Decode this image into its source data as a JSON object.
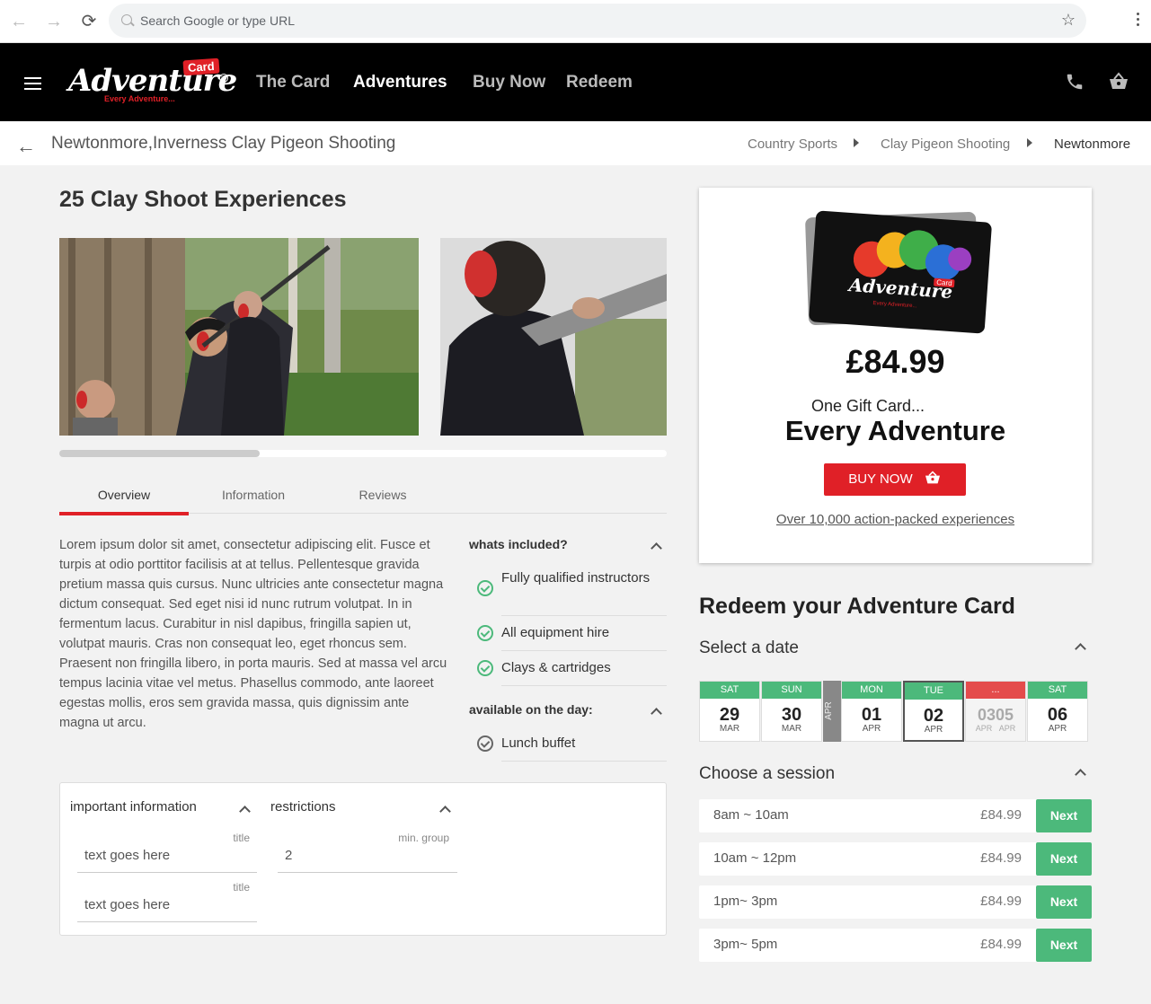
{
  "browser": {
    "search_placeholder": "Search Google or type URL"
  },
  "header": {
    "logo": {
      "word": "Adventure",
      "badge": "Card",
      "tagline": "Every Adventure...",
      "tm": "TM"
    },
    "nav": [
      "The Card",
      "Adventures",
      "Buy Now",
      "Redeem"
    ],
    "active_nav": "Adventures"
  },
  "breadcrumb": {
    "page_title": "Newtonmore,Inverness Clay Pigeon Shooting",
    "items": [
      "Country Sports",
      "Clay Pigeon Shooting",
      "Newtonmore"
    ]
  },
  "product": {
    "heading": "25 Clay Shoot Experiences",
    "carousel_scroll_fraction": 0.33,
    "tabs": [
      "Overview",
      "Information",
      "Reviews"
    ],
    "active_tab": "Overview",
    "overview": "Lorem ipsum dolor sit amet, consectetur adipiscing elit. Fusce et turpis at odio porttitor facilisis at at tellus. Pellentesque gravida pretium massa quis cursus. Nunc ultricies ante consectetur magna dictum consequat. Sed eget nisi id nunc rutrum volutpat. In in fermentum lacus. Curabitur in nisl dapibus, fringilla sapien ut, volutpat mauris. Cras non consequat leo, eget rhoncus sem. Praesent non fringilla libero, in porta mauris. Sed at massa vel arcu tempus lacinia vitae vel metus. Phasellus commodo, ante laoreet egestas mollis, eros sem gravida massa, quis dignissim ante magna ut arcu.",
    "included": {
      "title": "whats included?",
      "items": [
        "Fully qualified instructors",
        "All equipment hire",
        "Clays & cartridges"
      ]
    },
    "on_the_day": {
      "title": "available on the day:",
      "items": [
        "Lunch buffet"
      ]
    },
    "important": {
      "title": "important information",
      "fields": [
        {
          "label": "title",
          "value": "text goes here"
        },
        {
          "label": "title",
          "value": "text goes here"
        }
      ]
    },
    "restrictions": {
      "title": "restrictions",
      "fields": [
        {
          "label": "min. group",
          "value": "2"
        }
      ]
    }
  },
  "giftcard": {
    "card_word": "Adventure",
    "card_badge": "Card",
    "card_tagline": "Every Adventure...",
    "price": "£84.99",
    "line1": "One Gift Card...",
    "line2": "Every Adventure",
    "buy_label": "BUY NOW",
    "link": "Over 10,000 action-packed experiences"
  },
  "redeem": {
    "title": "Redeem your Adventure Card",
    "select_date": "Select a date",
    "month_divider": "APR",
    "dates": [
      {
        "dow": "SAT",
        "day": "29",
        "mon": "MAR"
      },
      {
        "dow": "SUN",
        "day": "30",
        "mon": "MAR"
      },
      {
        "dow": "MON",
        "day": "01",
        "mon": "APR"
      },
      {
        "dow": "TUE",
        "day": "02",
        "mon": "APR"
      },
      {
        "dow": "...",
        "day": "03",
        "day2": "05",
        "mon": "APR",
        "mon2": "APR"
      },
      {
        "dow": "SAT",
        "day": "06",
        "mon": "APR"
      }
    ],
    "choose_session": "Choose a session",
    "sessions": [
      {
        "time": "8am ~ 10am",
        "price": "£84.99",
        "action": "Next"
      },
      {
        "time": "10am ~ 12pm",
        "price": "£84.99",
        "action": "Next"
      },
      {
        "time": "1pm~ 3pm",
        "price": "£84.99",
        "action": "Next"
      },
      {
        "time": "3pm~ 5pm",
        "price": "£84.99",
        "action": "Next"
      }
    ]
  },
  "colors": {
    "accent_red": "#e02027",
    "accent_green": "#4cb97b",
    "header_bg": "#000000"
  }
}
